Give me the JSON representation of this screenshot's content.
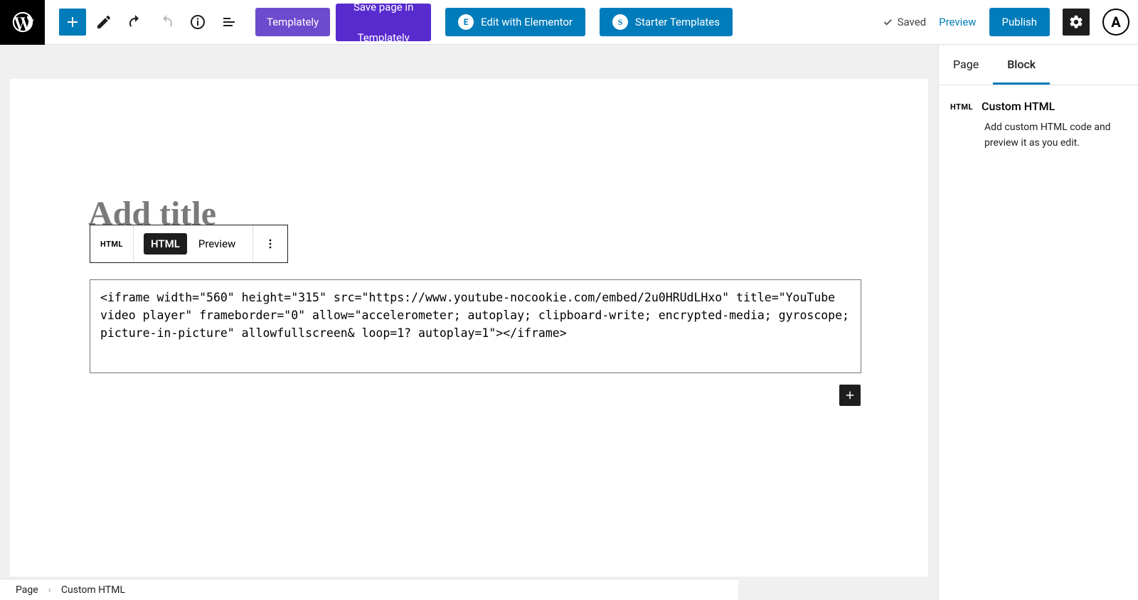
{
  "toolbar": {
    "templately_label": "Templately",
    "save_page_top": "Save page in",
    "save_page_bottom": "Templately",
    "elementor_label": "Edit with Elementor",
    "starter_label": "Starter Templates",
    "saved_label": "Saved",
    "preview_label": "Preview",
    "publish_label": "Publish",
    "astra_letter": "A"
  },
  "editor": {
    "title_placeholder": "Add title",
    "block_toolbar": {
      "icon_label": "HTML",
      "html_tab": "HTML",
      "preview_tab": "Preview"
    },
    "html_content": "<iframe width=\"560\" height=\"315\" src=\"https://www.youtube-nocookie.com/embed/2u0HRUdLHxo\" title=\"YouTube video player\" frameborder=\"0\" allow=\"accelerometer; autoplay; clipboard-write; encrypted-media; gyroscope; picture-in-picture\" allowfullscreen& loop=1? autoplay=1\"></iframe>"
  },
  "sidebar": {
    "tabs": {
      "page": "Page",
      "block": "Block"
    },
    "block_icon": "HTML",
    "block_title": "Custom HTML",
    "block_desc": "Add custom HTML code and preview it as you edit."
  },
  "breadcrumb": {
    "root": "Page",
    "current": "Custom HTML"
  }
}
